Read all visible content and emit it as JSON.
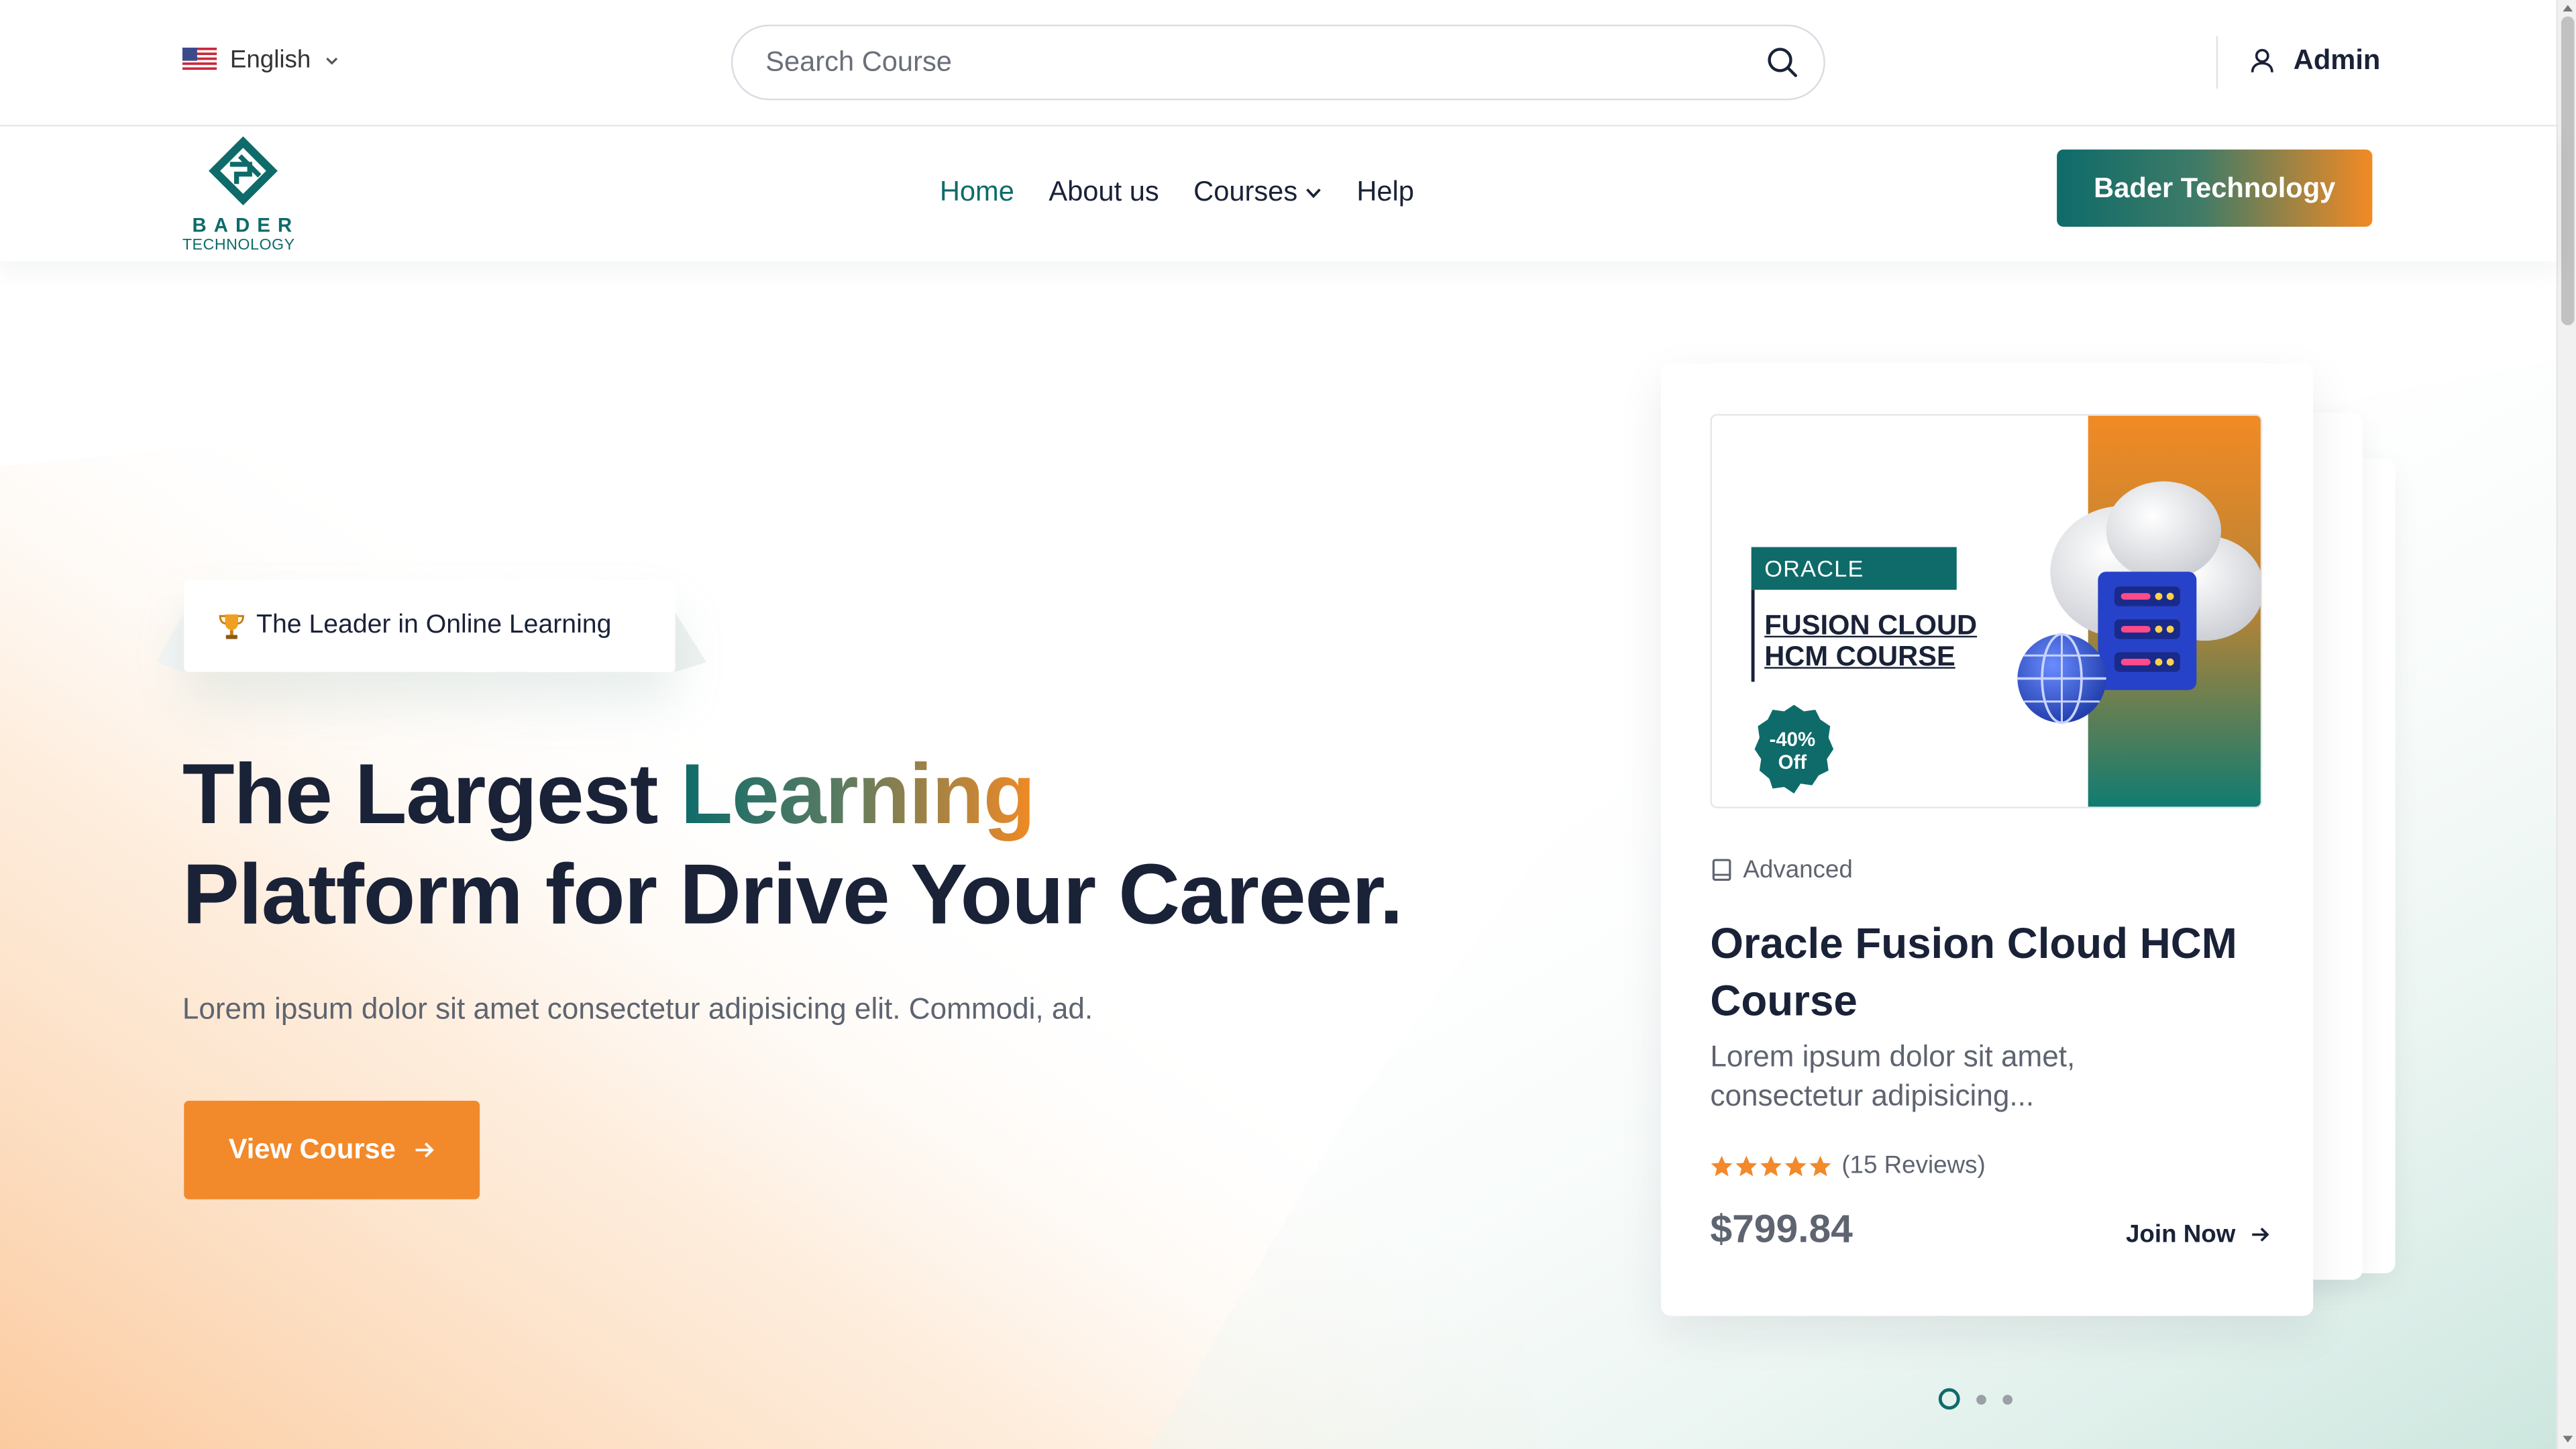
{
  "topbar": {
    "language": "English",
    "search_placeholder": "Search Course",
    "user_label": "Admin"
  },
  "brand": {
    "logo_line1": "BADER",
    "logo_line2": "TECHNOLOGY",
    "cta_label": "Bader Technology"
  },
  "nav": {
    "items": [
      "Home",
      "About us",
      "Courses",
      "Help"
    ],
    "active": "Home"
  },
  "hero": {
    "badge": "The Leader in Online Learning",
    "title_part1": "The Largest ",
    "title_highlight": "Learning",
    "title_part2": "Platform for Drive Your Career.",
    "lead": "Lorem ipsum dolor sit amet consectetur adipisicing elit. Commodi, ad.",
    "button": "View Course"
  },
  "course_card": {
    "thumb_tag": "ORACLE",
    "thumb_line1": "FUSION CLOUD",
    "thumb_line2": "HCM COURSE",
    "discount_line1": "-40%",
    "discount_line2": "Off",
    "level": "Advanced",
    "title": "Oracle Fusion Cloud HCM Course",
    "description": "Lorem ipsum dolor sit amet, consectetur adipisicing...",
    "rating_stars": 5,
    "reviews": "(15 Reviews)",
    "price": "$799.84",
    "join_label": "Join Now"
  },
  "carousel": {
    "total_slides": 3,
    "active_slide": 1
  },
  "colors": {
    "teal": "#0e6b6a",
    "orange": "#f2892a",
    "text_dark": "#1a2238",
    "text_muted": "#5e6470"
  }
}
